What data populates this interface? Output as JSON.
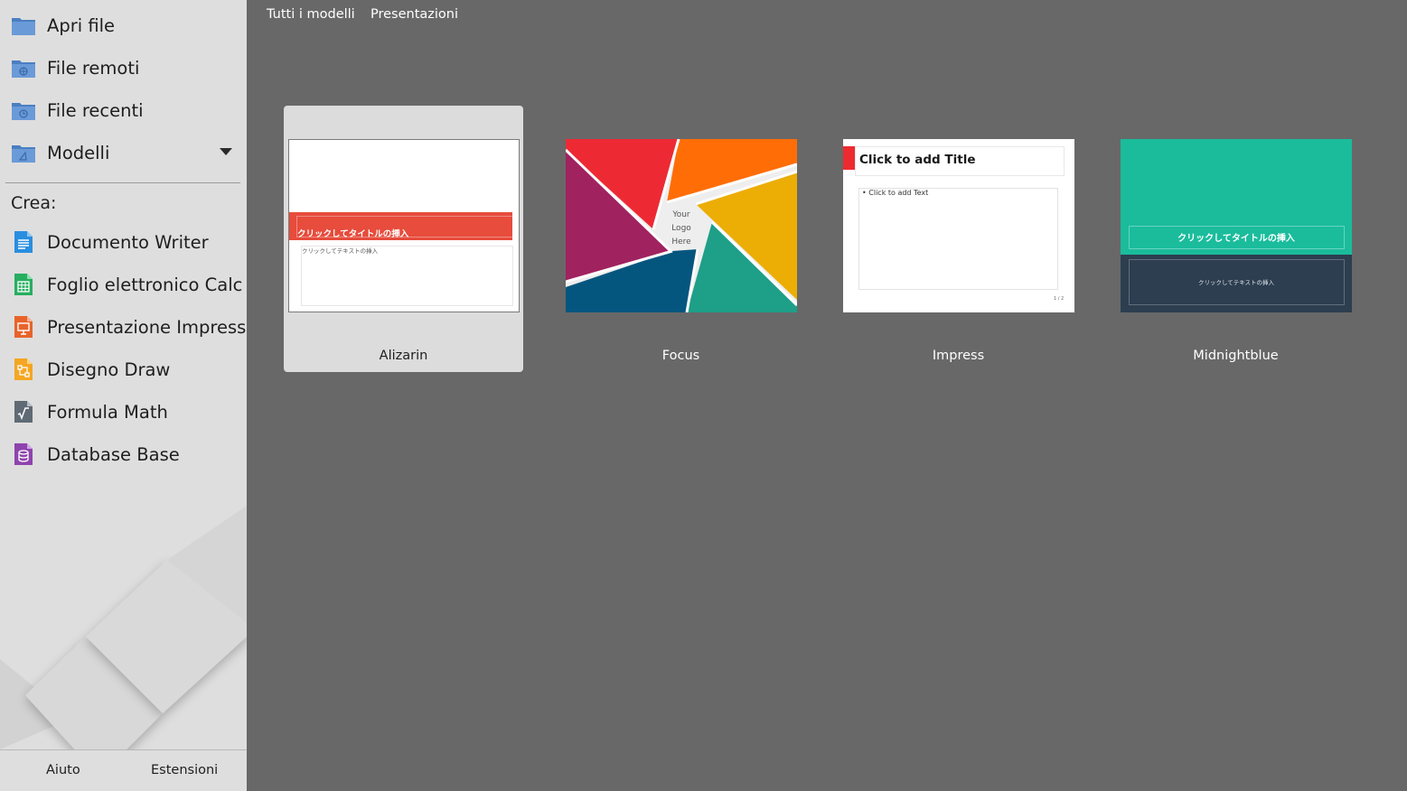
{
  "sidebar": {
    "items": [
      {
        "label": "Apri file",
        "icon": "folder-icon"
      },
      {
        "label": "File remoti",
        "icon": "remote-folder-icon"
      },
      {
        "label": "File recenti",
        "icon": "recent-folder-icon"
      },
      {
        "label": "Modelli",
        "icon": "templates-folder-icon"
      }
    ],
    "create_heading": "Crea:",
    "create_items": [
      {
        "label": "Documento Writer",
        "icon": "writer-icon",
        "color": "#2a8ee0"
      },
      {
        "label": "Foglio elettronico Calc",
        "icon": "calc-icon",
        "color": "#27ae60"
      },
      {
        "label": "Presentazione Impress",
        "icon": "impress-icon",
        "color": "#e8632a"
      },
      {
        "label": "Disegno Draw",
        "icon": "draw-icon",
        "color": "#f5a623"
      },
      {
        "label": "Formula Math",
        "icon": "math-icon",
        "color": "#5f6a75"
      },
      {
        "label": "Database Base",
        "icon": "base-icon",
        "color": "#8e44ad"
      }
    ],
    "help_label": "Aiuto",
    "extensions_label": "Estensioni"
  },
  "main": {
    "filters": {
      "all_templates": "Tutti i modelli",
      "category": "Presentazioni"
    },
    "templates": [
      {
        "name": "Alizarin",
        "selected": true,
        "title_text": "クリックしてタイトルの挿入",
        "body_text": "クリックしてテキストの挿入"
      },
      {
        "name": "Focus",
        "selected": false,
        "logo_line1": "Your",
        "logo_line2": "Logo",
        "logo_line3": "Here"
      },
      {
        "name": "Impress",
        "selected": false,
        "title_text": "Click to add Title",
        "body_text": "Click to add Text",
        "page_text": "1 / 2"
      },
      {
        "name": "Midnightblue",
        "selected": false,
        "title_text": "クリックしてタイトルの挿入",
        "body_text": "クリックしてテキストの挿入"
      }
    ]
  },
  "colors": {
    "sidebar_bg": "#dedede",
    "main_bg": "#686868",
    "selected_tile": "#dcdcdc",
    "alizarin_red": "#e74c3c",
    "midnight_teal": "#1abc9c",
    "midnight_navy": "#2c3e50"
  }
}
